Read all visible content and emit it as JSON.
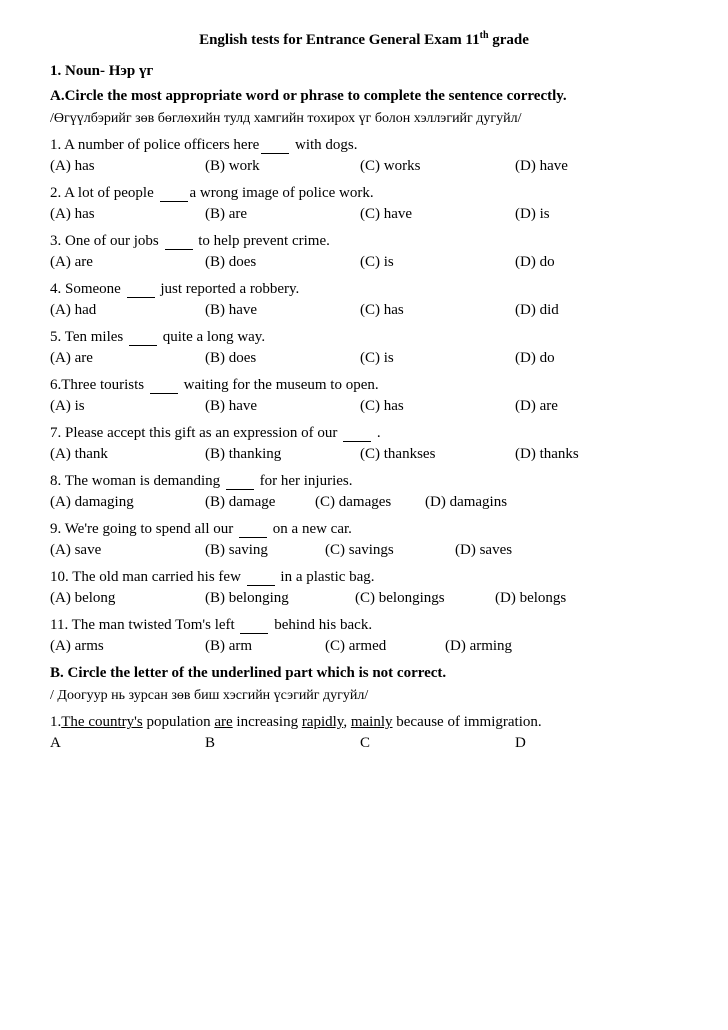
{
  "title": {
    "main": "English tests for Entrance General Exam 11",
    "sup": "th",
    "suffix": " grade"
  },
  "section1": {
    "heading": "1. Noun- Нэр үг",
    "instruction": "A.Circle the most appropriate word or phrase to complete the sentence correctly.",
    "mongolian": "/Өгүүлбэрийг зөв бөглөхийн тулд хамгийн тохирох үг болон хэллэгийг дугуйл/",
    "questions": [
      {
        "id": "q1",
        "text": "1. A number of police officers here",
        "blank": true,
        "suffix": " with dogs.",
        "options": [
          {
            "label": "(A)  has"
          },
          {
            "label": "(B)  work"
          },
          {
            "label": "(C)  works"
          },
          {
            "label": "(D)  have"
          }
        ]
      },
      {
        "id": "q2",
        "text": "2. A lot of people ",
        "blank": true,
        "suffix": "a wrong image of police work.",
        "options": [
          {
            "label": "(A)  has"
          },
          {
            "label": "(B)  are"
          },
          {
            "label": "(C)  have"
          },
          {
            "label": "(D)  is"
          }
        ]
      },
      {
        "id": "q3",
        "text": "3. One of our jobs ",
        "blank": true,
        "suffix": " to help prevent crime.",
        "options": [
          {
            "label": "(A)  are"
          },
          {
            "label": "(B)  does"
          },
          {
            "label": "(C)  is"
          },
          {
            "label": "(D)  do"
          }
        ]
      },
      {
        "id": "q4",
        "text": "4. Someone ",
        "blank": true,
        "suffix": " just reported a robbery.",
        "options": [
          {
            "label": "(A)  had"
          },
          {
            "label": "(B)  have"
          },
          {
            "label": "(C)  has"
          },
          {
            "label": "(D)  did"
          }
        ]
      },
      {
        "id": "q5",
        "text": "5. Ten miles ",
        "blank": true,
        "suffix": " quite  a long way.",
        "options": [
          {
            "label": "(A)  are"
          },
          {
            "label": "(B)  does"
          },
          {
            "label": "(C)  is"
          },
          {
            "label": "(D)  do"
          }
        ]
      },
      {
        "id": "q6",
        "text": "6.Three tourists ",
        "blank": true,
        "suffix": " waiting for the museum to open.",
        "options": [
          {
            "label": "(A)  is"
          },
          {
            "label": "(B)  have"
          },
          {
            "label": "(C)  has"
          },
          {
            "label": "(D)  are"
          }
        ]
      },
      {
        "id": "q7",
        "text": "7. Please accept this gift as an expression of our ",
        "blank": true,
        "suffix": " .",
        "options": [
          {
            "label": "(A)  thank"
          },
          {
            "label": "(B)  thanking"
          },
          {
            "label": "(C)  thankses"
          },
          {
            "label": "(D)  thanks"
          }
        ]
      },
      {
        "id": "q8",
        "text": "8. The woman is demanding ",
        "blank": true,
        "suffix": " for her injuries.",
        "options": [
          {
            "label": "(A)  damaging"
          },
          {
            "label": "(B)  damage"
          },
          {
            "label": "(C) damages"
          },
          {
            "label": "(D) damagins"
          }
        ],
        "compact": true
      },
      {
        "id": "q9",
        "text": "9. We're going to spend all our ",
        "blank": true,
        "suffix": " on a new car.",
        "options": [
          {
            "label": "(A)  save"
          },
          {
            "label": "(B)  saving"
          },
          {
            "label": "(C)  savings"
          },
          {
            "label": "(D)  saves"
          }
        ],
        "compact": true
      },
      {
        "id": "q10",
        "text": "10. The old man carried his few ",
        "blank": true,
        "suffix": " in a plastic bag.",
        "options": [
          {
            "label": "(A)  belong"
          },
          {
            "label": "(B)  belonging"
          },
          {
            "label": "(C)  belongings"
          },
          {
            "label": "(D)  belongs"
          }
        ],
        "compact2": true
      },
      {
        "id": "q11",
        "text": "11. The man twisted Tom's left ",
        "blank": true,
        "suffix": " behind his back.",
        "options": [
          {
            "label": "(A)  arms"
          },
          {
            "label": "(B)  arm"
          },
          {
            "label": "(C)  armed"
          },
          {
            "label": "(D)  arming"
          }
        ],
        "compact": true
      }
    ]
  },
  "sectionB": {
    "instruction": "B. Circle the letter of the underlined part which is not correct.",
    "mongolian": "/ Доогуур нь зурсан зөв биш хэсгийн үсэгийг дугуйл/",
    "q1": {
      "text_parts": [
        {
          "text": "1.",
          "underline": false
        },
        {
          "text": "The country's",
          "underline": true
        },
        {
          "text": " population ",
          "underline": false
        },
        {
          "text": "are",
          "underline": true
        },
        {
          "text": " increasing ",
          "underline": false
        },
        {
          "text": "rapidly",
          "underline": true
        },
        {
          "text": ", ",
          "underline": false
        },
        {
          "text": "mainly",
          "underline": true
        },
        {
          "text": " because of immigration.",
          "underline": false
        }
      ],
      "letters": [
        "A",
        "B",
        "C",
        "D"
      ]
    }
  }
}
